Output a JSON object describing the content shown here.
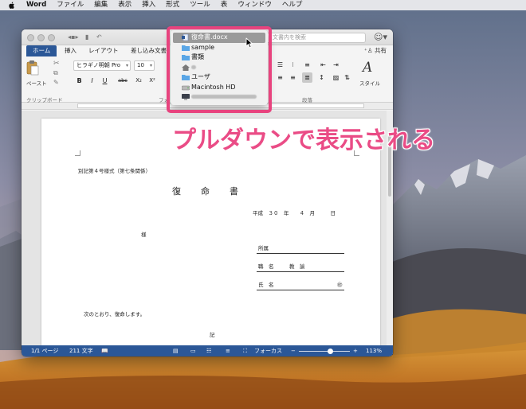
{
  "menubar": {
    "app_name": "Word",
    "items": [
      "ファイル",
      "編集",
      "表示",
      "挿入",
      "形式",
      "ツール",
      "表",
      "ウィンドウ",
      "ヘルプ"
    ]
  },
  "titlebar": {
    "search_placeholder": "文書内を検索",
    "feedback_icon": "smiley-icon"
  },
  "ribbon": {
    "tabs": [
      "ホーム",
      "挿入",
      "レイアウト",
      "差し込み文書"
    ],
    "active_tab": "ホーム",
    "share_label": "共有",
    "font_name": "ヒラギノ明朝 Pro",
    "font_size": "10",
    "paste_label": "ペースト",
    "clipboard_group": "クリップボード",
    "font_group_partial": "フォ",
    "paragraph_group": "段落",
    "styles_label": "スタイル",
    "format_buttons": [
      "B",
      "I",
      "U",
      "abc",
      "X₂",
      "X²"
    ]
  },
  "dropdown": {
    "items": [
      {
        "label": "復命書.docx",
        "icon": "document-icon",
        "selected": true
      },
      {
        "label": "sample",
        "icon": "folder-icon",
        "selected": false
      },
      {
        "label": "書類",
        "icon": "folder-icon",
        "selected": false
      },
      {
        "label": "",
        "icon": "home-icon",
        "selected": false,
        "blurred": true
      },
      {
        "label": "ユーザ",
        "icon": "folder-icon",
        "selected": false
      },
      {
        "label": "Macintosh HD",
        "icon": "drive-icon",
        "selected": false
      },
      {
        "label": "",
        "icon": "computer-icon",
        "selected": false,
        "blurred": true
      }
    ]
  },
  "annotation": {
    "text": "プルダウンで表示される",
    "color": "#ea4c86"
  },
  "document": {
    "form_header": "別記第４号様式（第七条関係）",
    "title": "復　　命　　書",
    "date_line": "平成　３０　年　　４　月　　　日",
    "addressee_suffix": "様",
    "affiliation_label": "所属",
    "position_label": "職　名　　　教　諭",
    "name_label": "氏　名",
    "seal_mark": "㊞",
    "body_text": "次のとおり、復命します。",
    "record_heading": "記"
  },
  "statusbar": {
    "page": "1/1 ページ",
    "word_count": "211 文字",
    "focus_label": "フォーカス",
    "zoom_percent": "113%",
    "zoom_level": 0.62
  },
  "colors": {
    "accent": "#2b5797",
    "highlight": "#e8437e"
  }
}
